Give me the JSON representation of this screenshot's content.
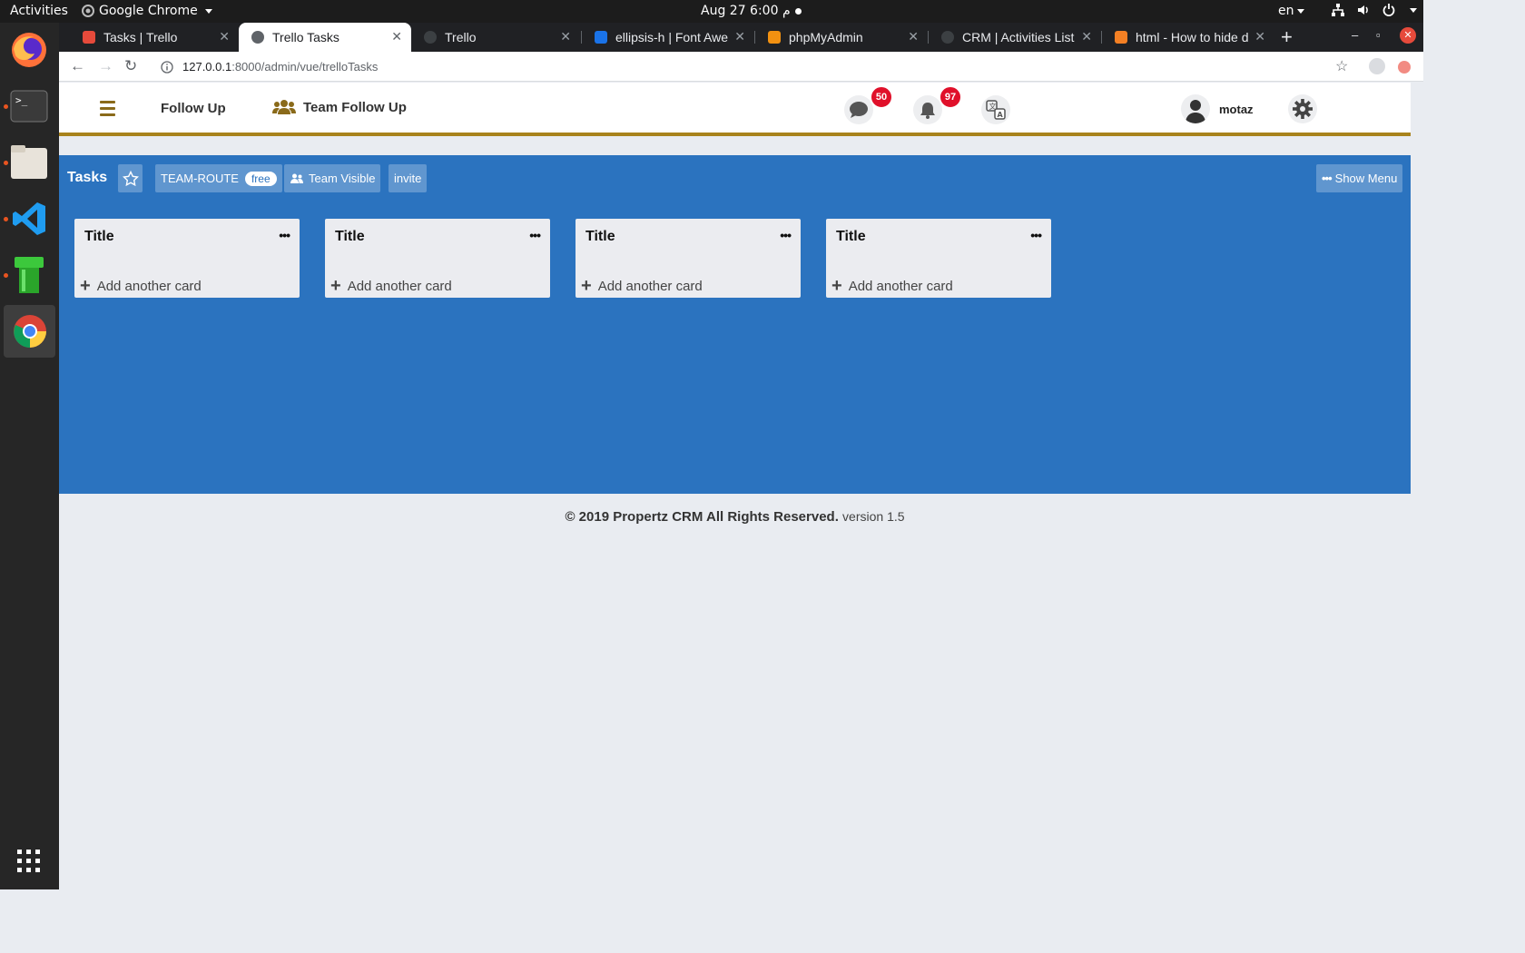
{
  "os": {
    "activities": "Activities",
    "app_menu": "Google Chrome",
    "clock": "Aug 27  6:00 م",
    "lang": "en"
  },
  "browser": {
    "tabs": [
      {
        "title": "Tasks | Trello",
        "favicon_color": "#e64a3b"
      },
      {
        "title": "Trello Tasks",
        "favicon_color": "#5f6368"
      },
      {
        "title": "Trello",
        "favicon_color": "#3c4043"
      },
      {
        "title": "ellipsis-h | Font Awe",
        "favicon_color": "#1a73e8"
      },
      {
        "title": "phpMyAdmin",
        "favicon_color": "#f29111"
      },
      {
        "title": "CRM | Activities List",
        "favicon_color": "#3c4043"
      },
      {
        "title": "html - How to hide d",
        "favicon_color": "#f48024"
      }
    ],
    "url_host": "127.0.0.1",
    "url_path": ":8000/admin/vue/trelloTasks"
  },
  "header": {
    "follow_up": "Follow Up",
    "team_follow_up": "Team Follow Up",
    "messages_count": "50",
    "notifications_count": "97",
    "username": "motaz",
    "accent_color": "#a8831c"
  },
  "board": {
    "title": "Tasks",
    "team_label": "TEAM-ROUTE",
    "plan_pill": "free",
    "visibility": "Team Visible",
    "invite": "invite",
    "show_menu": "Show Menu",
    "background": "#2b73bf",
    "lists": [
      {
        "title": "Title",
        "add_card": "Add another card"
      },
      {
        "title": "Title",
        "add_card": "Add another card"
      },
      {
        "title": "Title",
        "add_card": "Add another card"
      },
      {
        "title": "Title",
        "add_card": "Add another card"
      }
    ]
  },
  "footer": {
    "copyright": "© 2019 Propertz CRM All Rights Reserved.",
    "version": "version 1.5"
  }
}
